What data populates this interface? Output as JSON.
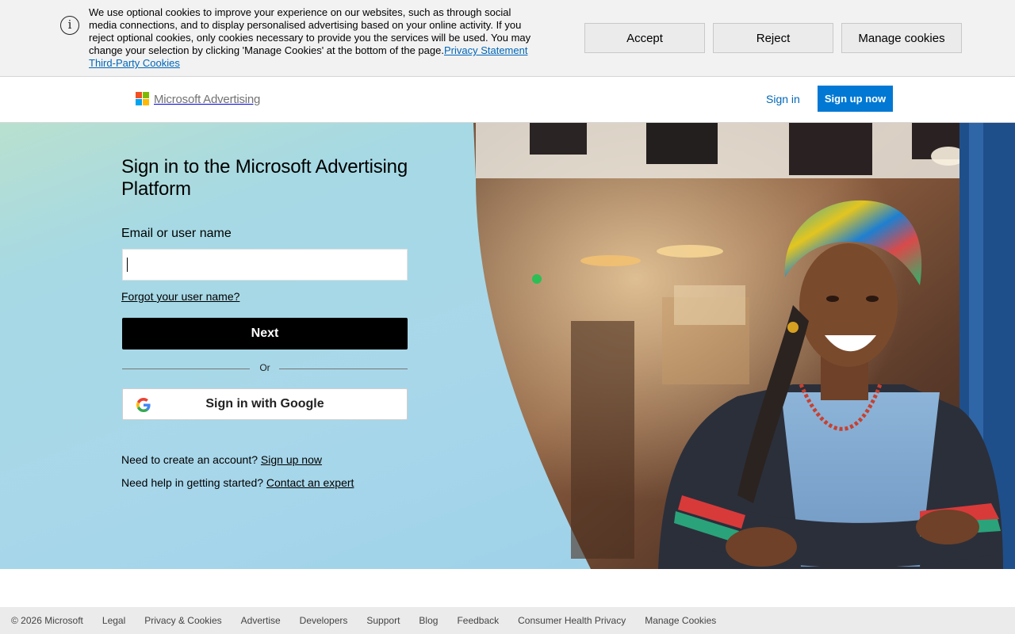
{
  "cookie_banner": {
    "text": "We use optional cookies to improve your experience on our websites, such as through social media connections, and to display personalised advertising based on your online activity. If you reject optional cookies, only cookies necessary to provide you the services will be used. You may change your selection by clicking 'Manage Cookies' at the bottom of the page.",
    "privacy_link": "Privacy Statement",
    "third_party_link": "Third-Party Cookies",
    "accept": "Accept",
    "reject": "Reject",
    "manage": "Manage cookies",
    "icon": "info-icon"
  },
  "header": {
    "logo_text": "Microsoft Advertising",
    "logo_colors": [
      "#f25022",
      "#7fba00",
      "#00a4ef",
      "#ffb900"
    ],
    "sign_in": "Sign in",
    "sign_up": "Sign up now"
  },
  "signin": {
    "title": "Sign in to the Microsoft Advertising Platform",
    "email_label": "Email or user name",
    "email_value": "",
    "forgot": "Forgot your user name?",
    "next": "Next",
    "or": "Or",
    "google": "Sign in with Google",
    "create_prefix": "Need to create an account?",
    "create_link": "Sign up now",
    "help_prefix": "Need help in getting started?",
    "help_link": "Contact an expert"
  },
  "footer": {
    "copyright": "© 2026 Microsoft",
    "links": [
      "Legal",
      "Privacy & Cookies",
      "Advertise",
      "Developers",
      "Support",
      "Blog",
      "Feedback",
      "Consumer Health Privacy",
      "Manage Cookies"
    ]
  },
  "colors": {
    "link_blue": "#0067b8",
    "primary_blue": "#0078d4",
    "next_button": "#000000"
  }
}
